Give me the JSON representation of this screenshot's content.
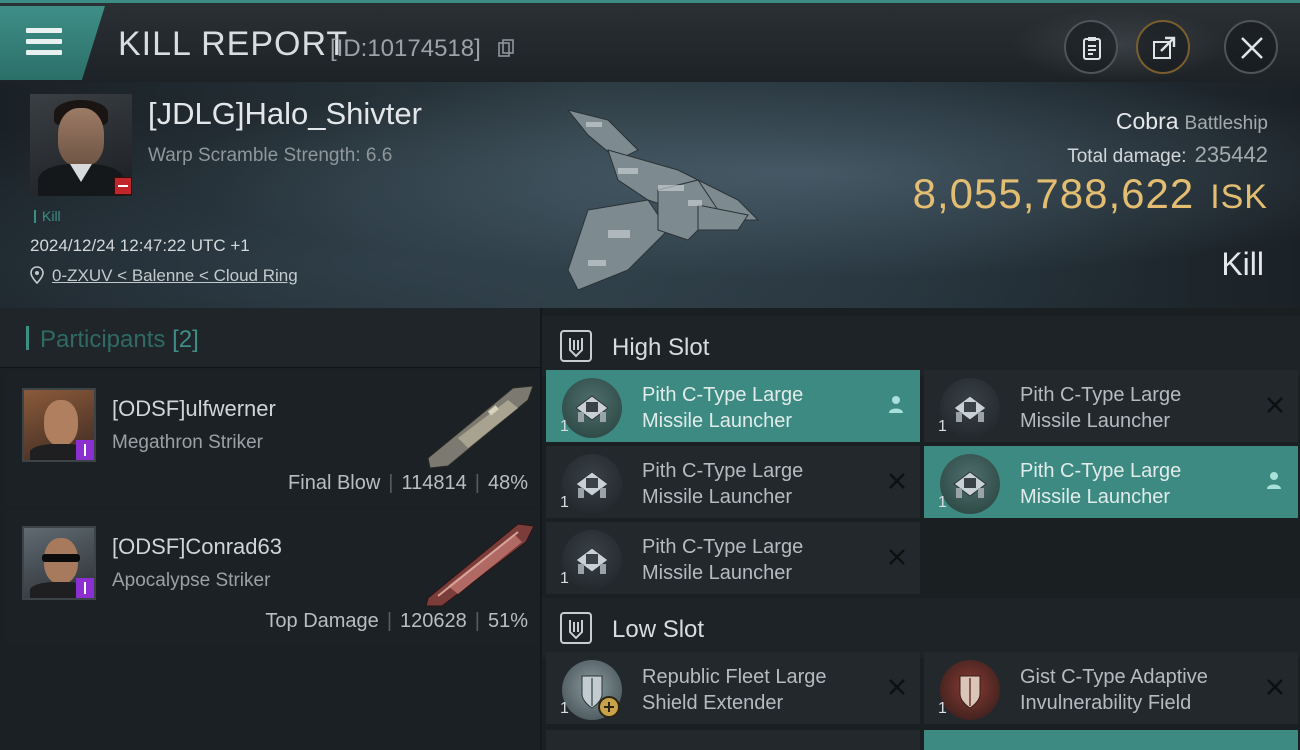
{
  "header": {
    "title": "KILL REPORT",
    "report_id": "[ID:10174518]",
    "icons": [
      "menu-icon",
      "copy-icon",
      "clipboard-icon",
      "share-icon",
      "close-icon"
    ]
  },
  "victim": {
    "name": "[JDLG]Halo_Shivter",
    "warp_scramble": "Warp Scramble Strength: 6.6",
    "tag": "Kill",
    "datetime": "2024/12/24 12:47:22 UTC +1",
    "location": "0-ZXUV < Balenne < Cloud Ring",
    "ship_name": "Cobra",
    "ship_class": "Battleship",
    "total_damage_label": "Total damage:",
    "total_damage": "235442",
    "isk_value": "8,055,788,622",
    "isk_unit": "ISK",
    "result": "Kill"
  },
  "participants": {
    "label": "Participants",
    "count": "[2]",
    "items": [
      {
        "name": "[ODSF]ulfwerner",
        "ship": "Megathron Striker",
        "stat_label": "Final Blow",
        "damage": "114814",
        "percent": "48%"
      },
      {
        "name": "[ODSF]Conrad63",
        "ship": "Apocalypse Striker",
        "stat_label": "Top Damage",
        "damage": "120628",
        "percent": "51%"
      }
    ]
  },
  "slots": {
    "high": {
      "label": "High Slot",
      "modules": [
        {
          "line1": "Pith C-Type Large",
          "line2": "Missile Launcher",
          "qty": "1"
        },
        {
          "line1": "Pith C-Type Large",
          "line2": "Missile Launcher",
          "qty": "1"
        },
        {
          "line1": "Pith C-Type Large",
          "line2": "Missile Launcher",
          "qty": "1"
        },
        {
          "line1": "Pith C-Type Large",
          "line2": "Missile Launcher",
          "qty": "1"
        },
        {
          "line1": "Pith C-Type Large",
          "line2": "Missile Launcher",
          "qty": "1"
        }
      ]
    },
    "low": {
      "label": "Low Slot",
      "modules": [
        {
          "line1": "Republic Fleet Large",
          "line2": "Shield Extender",
          "qty": "1"
        },
        {
          "line1": "Gist C-Type Adaptive",
          "line2": "Invulnerability Field",
          "qty": "1"
        }
      ]
    }
  },
  "colors": {
    "accent": "#3c8a82",
    "isk_gold": "#e2bd72",
    "badge_red": "#c0262a",
    "badge_purple": "#8b2fd1"
  }
}
